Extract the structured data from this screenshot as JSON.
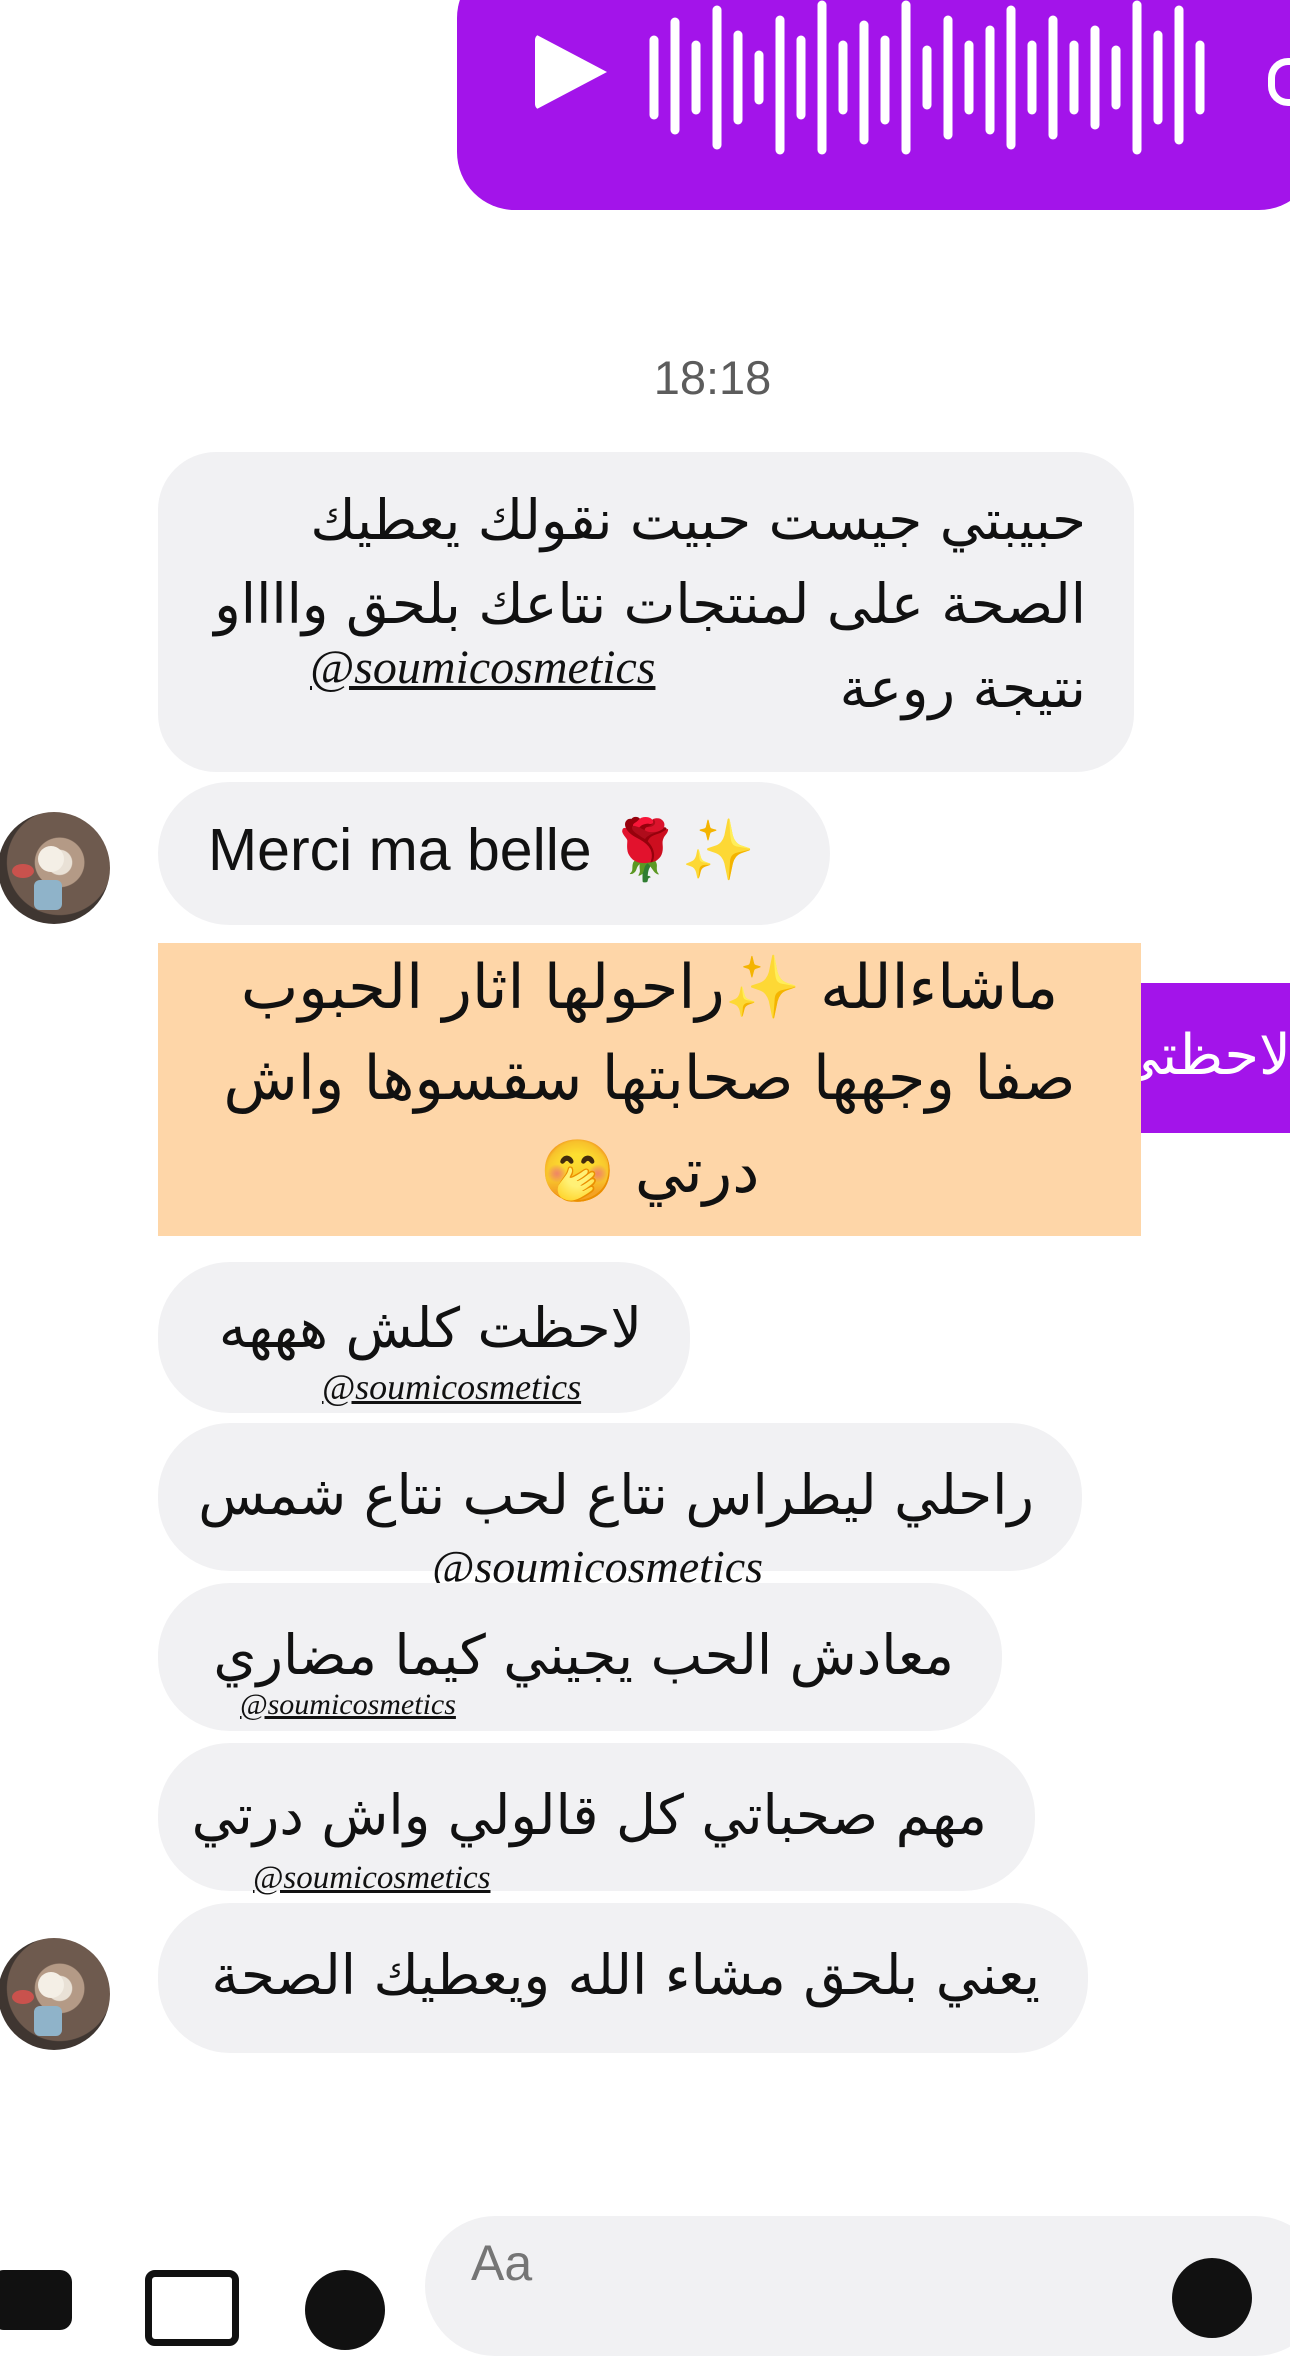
{
  "voice_message": {
    "state": "paused"
  },
  "timestamp": "18:18",
  "messages": {
    "m1_lines": [
      "حبيبتي جيست حبيت نقولك يعطيك",
      "الصحة على لمنتجات نتاعك بلحق وااااو",
      "نتيجة روعة"
    ],
    "m1_handle": "@soumicosmetics",
    "m2": "Merci ma belle 🌹✨",
    "highlight_lines": [
      "ماشاءالله ✨راحولها اثار الحبوب",
      "صفا وجهها صحابتها سقسوها واش",
      "درتي 🤭"
    ],
    "peek": "لاحظتي",
    "m3": "لاحظت كلش هههه",
    "m3_handle": "@soumicosmetics",
    "m4": "راحلي ليطراس نتاع لحب نتاع شمس",
    "m4_handle": "@soumicosmetics",
    "m5": "معادش الحب يجيني كيما مضاري",
    "m5_handle": "@soumicosmetics",
    "m6": "مهم صحباتي كل قالولي واش درتي",
    "m6_handle": "@soumicosmetics",
    "m7": "يعني بلحق مشاء الله ويعطيك الصحة"
  },
  "composer": {
    "placeholder": "Aa"
  },
  "colors": {
    "accent": "#a314ea",
    "bubble": "#f1f1f3",
    "highlight": "#fed6a8"
  }
}
